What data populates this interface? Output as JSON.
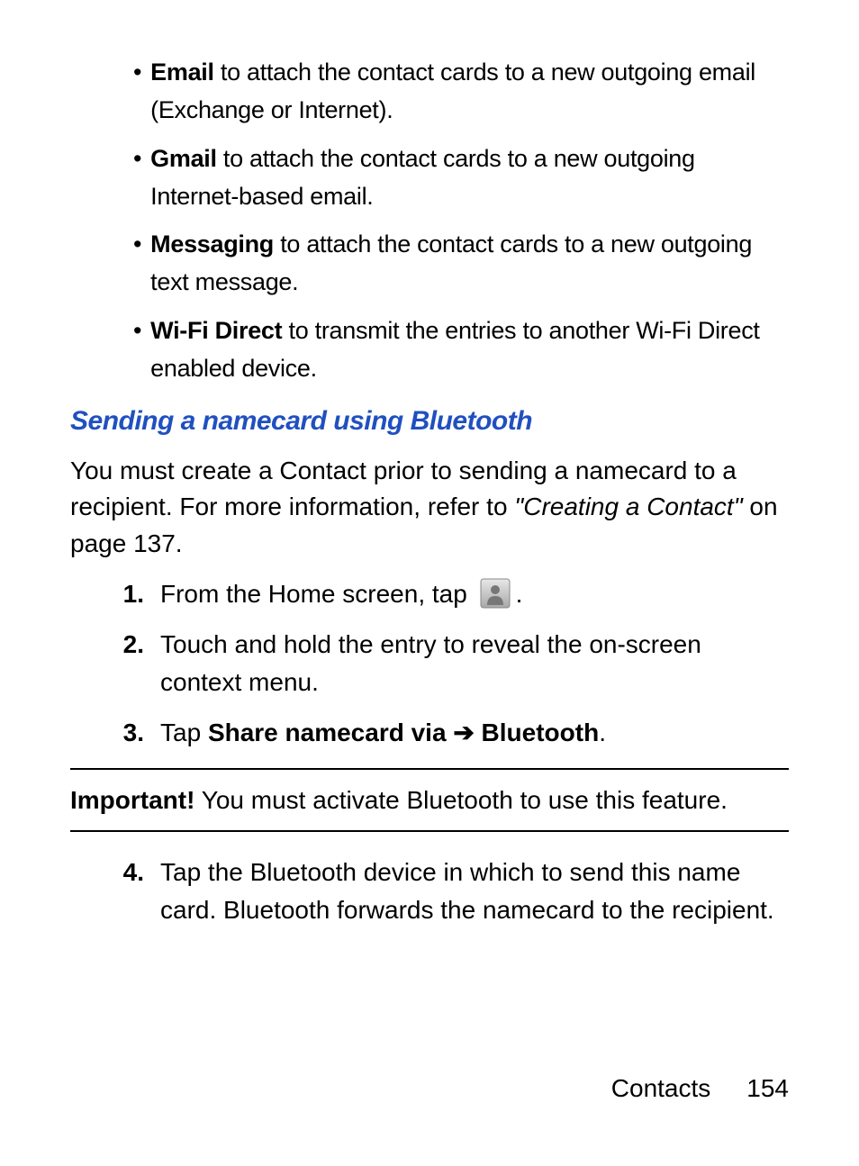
{
  "bullets": [
    {
      "label": "Email",
      "text": " to attach the contact cards to a new outgoing email (Exchange or Internet)."
    },
    {
      "label": "Gmail",
      "text": " to attach the contact cards to a new outgoing Internet-based email."
    },
    {
      "label": "Messaging",
      "text": " to attach the contact cards to a new outgoing text message."
    },
    {
      "label": "Wi-Fi Direct",
      "text": " to transmit the entries to another Wi-Fi Direct enabled device."
    }
  ],
  "heading": "Sending a namecard using Bluetooth",
  "intro": {
    "pre": "You must create a Contact prior to sending a namecard to a recipient. For more information, refer to ",
    "ref": "\"Creating a Contact\"",
    "post": "  on page 137."
  },
  "steps": {
    "s1": {
      "num": "1.",
      "pre": "From the Home screen, tap ",
      "post": "."
    },
    "s2": {
      "num": "2.",
      "text": "Touch and hold the entry to reveal the on-screen context menu."
    },
    "s3": {
      "num": "3.",
      "tap": "Tap ",
      "bold1": "Share namecard via ",
      "arrow": "➔",
      "bold2": " Bluetooth",
      "end": "."
    },
    "s4": {
      "num": "4.",
      "text": "Tap the Bluetooth device in which to send this name card. Bluetooth forwards the namecard to the recipient."
    }
  },
  "important": {
    "label": "Important!",
    "text": " You must activate Bluetooth to use this feature."
  },
  "footer": {
    "section": "Contacts",
    "page": "154"
  }
}
